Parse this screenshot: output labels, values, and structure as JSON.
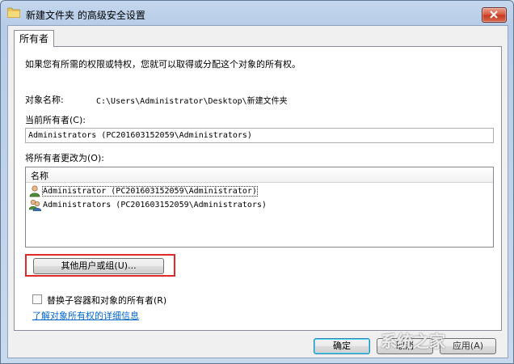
{
  "window": {
    "title": "新建文件夹 的高级安全设置"
  },
  "tabs": [
    {
      "label": "所有者"
    }
  ],
  "owner": {
    "intro_text": "如果您有所需的权限或特权，您就可以取得或分配这个对象的所有权。",
    "object_name_label": "对象名称:",
    "object_name_value": "C:\\Users\\Administrator\\Desktop\\新建文件夹",
    "current_owner_label": "当前所有者(C):",
    "current_owner_value": "Administrators (PC201603152059\\Administrators)",
    "change_owner_label": "将所有者更改为(O):",
    "list_header": "名称",
    "list_items": [
      {
        "label": "Administrator (PC201603152059\\Administrator)",
        "icon": "user-icon"
      },
      {
        "label": "Administrators (PC201603152059\\Administrators)",
        "icon": "group-icon"
      }
    ],
    "other_users_button": "其他用户或组(U)...",
    "replace_checkbox_label": "替换子容器和对象的所有者(R)",
    "replace_checked": false,
    "learn_more_link": "了解对象所有权的详细信息"
  },
  "footer": {
    "ok_label": "确定",
    "cancel_label": "取消",
    "apply_label": "应用(A)"
  },
  "watermark": "系统之家",
  "colors": {
    "highlight_box": "#e0292b",
    "link": "#0066cc",
    "close_button": "#c7361d"
  }
}
